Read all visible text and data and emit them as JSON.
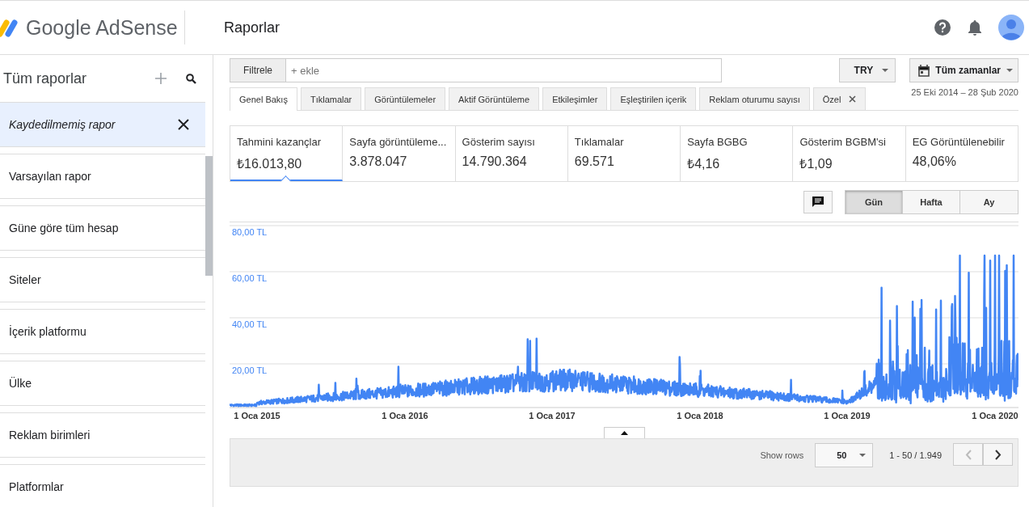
{
  "header": {
    "logo_text": "Google AdSense",
    "page_title": "Raporlar"
  },
  "sidebar": {
    "title": "Tüm raporlar",
    "items": [
      {
        "label": "Kaydedilmemiş rapor",
        "selected": true,
        "kind": "unsaved"
      },
      {
        "label": "Varsayılan rapor",
        "selected": false,
        "kind": "saved"
      },
      {
        "label": "Güne göre tüm hesap",
        "selected": false,
        "kind": "saved"
      },
      {
        "label": "Siteler",
        "selected": false,
        "kind": "saved"
      },
      {
        "label": "İçerik platformu",
        "selected": false,
        "kind": "saved"
      },
      {
        "label": "Ülke",
        "selected": false,
        "kind": "saved"
      },
      {
        "label": "Reklam birimleri",
        "selected": false,
        "kind": "saved"
      },
      {
        "label": "Platformlar",
        "selected": false,
        "kind": "saved"
      }
    ]
  },
  "filter": {
    "button": "Filtrele",
    "placeholder": "+ ekle"
  },
  "currency": "TRY",
  "date_range": {
    "label": "Tüm zamanlar",
    "dates": "25 Eki 2014 – 28 Şub 2020"
  },
  "tabs": [
    {
      "label": "Genel Bakış",
      "selected": true,
      "closable": false
    },
    {
      "label": "Tıklamalar",
      "selected": false,
      "closable": false
    },
    {
      "label": "Görüntülemeler",
      "selected": false,
      "closable": false
    },
    {
      "label": "Aktif Görüntüleme",
      "selected": false,
      "closable": false
    },
    {
      "label": "Etkileşimler",
      "selected": false,
      "closable": false
    },
    {
      "label": "Eşleştirilen içerik",
      "selected": false,
      "closable": false
    },
    {
      "label": "Reklam oturumu sayısı",
      "selected": false,
      "closable": false
    },
    {
      "label": "Özel",
      "selected": false,
      "closable": true
    }
  ],
  "metrics": [
    {
      "label": "Tahmini kazançlar",
      "value": "₺16.013,80",
      "selected": true
    },
    {
      "label": "Sayfa görüntüleme...",
      "value": "3.878.047",
      "selected": false
    },
    {
      "label": "Gösterim sayısı",
      "value": "14.790.364",
      "selected": false
    },
    {
      "label": "Tıklamalar",
      "value": "69.571",
      "selected": false
    },
    {
      "label": "Sayfa BGBG",
      "value": "₺4,16",
      "selected": false
    },
    {
      "label": "Gösterim BGBM'si",
      "value": "₺1,09",
      "selected": false
    },
    {
      "label": "EG Görüntülenebilir",
      "value": "48,06%",
      "selected": false
    }
  ],
  "granularity": [
    {
      "label": "Gün",
      "selected": true
    },
    {
      "label": "Hafta",
      "selected": false
    },
    {
      "label": "Ay",
      "selected": false
    }
  ],
  "chart": {
    "y_labels": [
      "80,00 TL",
      "60,00 TL",
      "40,00 TL",
      "20,00 TL"
    ],
    "x_labels": [
      "1 Oca 2015",
      "1 Oca 2016",
      "1 Oca 2017",
      "1 Oca 2018",
      "1 Oca 2019",
      "1 Oca 2020"
    ]
  },
  "pagination": {
    "show_rows_label": "Show rows",
    "rows": "50",
    "range": "1 - 50 / 1.949"
  }
}
